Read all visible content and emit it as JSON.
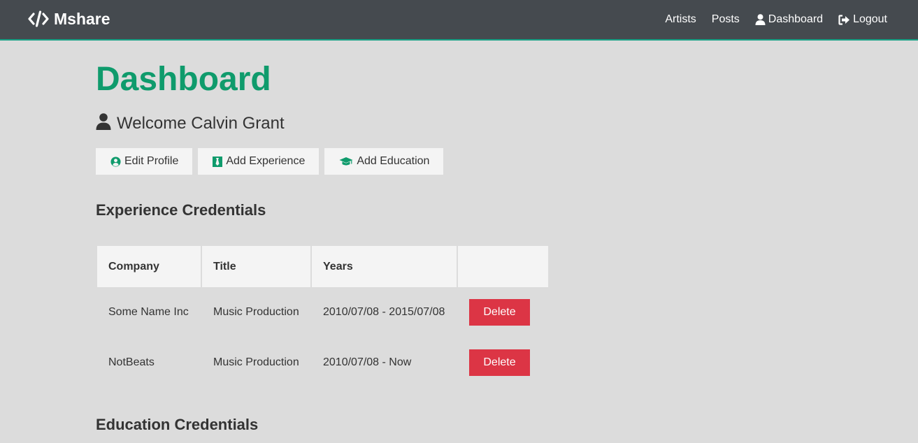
{
  "navbar": {
    "brand": "Mshare",
    "links": [
      {
        "label": "Artists"
      },
      {
        "label": "Posts"
      },
      {
        "label": "Dashboard",
        "icon": "user-icon"
      },
      {
        "label": "Logout",
        "icon": "sign-out-icon"
      }
    ]
  },
  "page": {
    "title": "Dashboard",
    "welcome": "Welcome Calvin Grant"
  },
  "actions": {
    "edit_profile": "Edit Profile",
    "add_experience": "Add Experience",
    "add_education": "Add Education"
  },
  "experience": {
    "heading": "Experience Credentials",
    "columns": [
      "Company",
      "Title",
      "Years",
      ""
    ],
    "rows": [
      {
        "company": "Some Name Inc",
        "title": "Music Production",
        "years": "2010/07/08 - 2015/07/08",
        "action": "Delete"
      },
      {
        "company": "NotBeats",
        "title": "Music Production",
        "years": "2010/07/08 - Now",
        "action": "Delete"
      }
    ]
  },
  "education": {
    "heading": "Education Credentials"
  },
  "colors": {
    "navbar_bg": "#454a4f",
    "accent_green": "#0f9b6c",
    "danger": "#dc3545",
    "page_bg": "#dcdcdc"
  }
}
